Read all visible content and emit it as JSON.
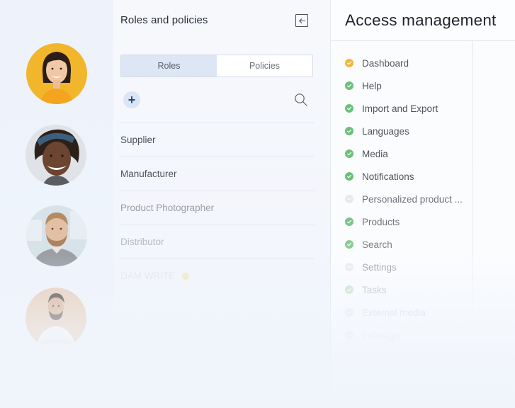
{
  "avatars": [
    {
      "name": "avatar-woman-yellow",
      "bg": "#f3b72e"
    },
    {
      "name": "avatar-woman-headband",
      "bg": "#d9dde2"
    },
    {
      "name": "avatar-man-beard-sweater",
      "bg": "#c9d6e0"
    },
    {
      "name": "avatar-man-white-shirt",
      "bg": "#e2c3a8"
    }
  ],
  "roles_panel": {
    "title": "Roles and policies",
    "collapse_icon": "arrow-left-collapse-icon",
    "tabs": [
      {
        "label": "Roles",
        "active": true
      },
      {
        "label": "Policies",
        "active": false
      }
    ],
    "add_icon": "+",
    "search_icon": "search-icon",
    "roles": [
      {
        "label": "Supplier",
        "color": "#4a4f58"
      },
      {
        "label": "Manufacturer",
        "color": "#4f545c"
      },
      {
        "label": "Product Photographer",
        "color": "#9a9ea6"
      },
      {
        "label": "Distributor",
        "color": "#b6bac1"
      },
      {
        "label": "DAM WRITE",
        "color": "#e3e6ea"
      }
    ]
  },
  "access_panel": {
    "title": "Access management",
    "permissions": [
      {
        "label": "Dashboard",
        "status": "warning",
        "color": "#50555d",
        "icon_color": "#f3b63a"
      },
      {
        "label": "Help",
        "status": "granted",
        "color": "#50555d",
        "icon_color": "#6dc07a"
      },
      {
        "label": "Import and Export",
        "status": "granted",
        "color": "#50555d",
        "icon_color": "#6dc07a"
      },
      {
        "label": "Languages",
        "status": "granted",
        "color": "#50555d",
        "icon_color": "#6dc07a"
      },
      {
        "label": "Media",
        "status": "granted",
        "color": "#50555d",
        "icon_color": "#6dc07a"
      },
      {
        "label": "Notifications",
        "status": "granted",
        "color": "#50555d",
        "icon_color": "#6dc07a"
      },
      {
        "label": "Personalized product ...",
        "status": "none",
        "color": "#6e727a",
        "icon_color": "#e7e9ed"
      },
      {
        "label": "Products",
        "status": "granted",
        "color": "#70747b",
        "icon_color": "#7cc587"
      },
      {
        "label": "Search",
        "status": "granted",
        "color": "#7d8188",
        "icon_color": "#8ccc95"
      },
      {
        "label": "Settings",
        "status": "none",
        "color": "#a4a8ae",
        "icon_color": "#eceef1"
      },
      {
        "label": "Tasks",
        "status": "granted",
        "color": "#c0c4ca",
        "icon_color": "#c9e7cd"
      },
      {
        "label": "External media",
        "status": "none",
        "color": "#dde1e6",
        "icon_color": "#eef1f5"
      },
      {
        "label": "InDesign",
        "status": "none",
        "color": "#e8ecf1",
        "icon_color": "#f0f3f7"
      }
    ]
  }
}
